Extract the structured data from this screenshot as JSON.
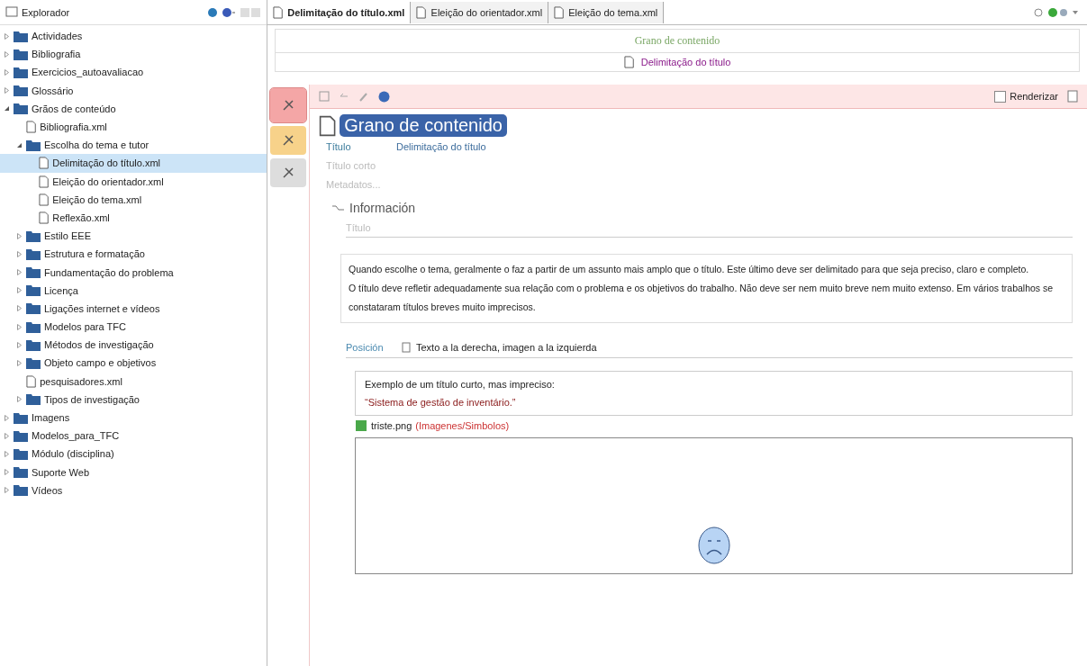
{
  "explorer": {
    "title": "Explorador",
    "tree": [
      {
        "label": "Actividades",
        "kind": "folder",
        "expanded": false,
        "selected": false
      },
      {
        "label": "Bibliografia",
        "kind": "folder",
        "expanded": false,
        "selected": false
      },
      {
        "label": "Exercicios_autoavaliacao",
        "kind": "folder",
        "expanded": false,
        "selected": false
      },
      {
        "label": "Glossário",
        "kind": "folder",
        "expanded": false,
        "selected": false
      },
      {
        "label": "Grãos de conteúdo",
        "kind": "folder",
        "expanded": true,
        "selected": false,
        "children": [
          {
            "label": "Bibliografia.xml",
            "kind": "file",
            "selected": false
          },
          {
            "label": "Escolha do tema e tutor",
            "kind": "folder",
            "expanded": true,
            "selected": false,
            "children": [
              {
                "label": "Delimitação do título.xml",
                "kind": "file",
                "selected": true
              },
              {
                "label": "Eleição do orientador.xml",
                "kind": "file",
                "selected": false
              },
              {
                "label": "Eleição do tema.xml",
                "kind": "file",
                "selected": false
              },
              {
                "label": "Reflexão.xml",
                "kind": "file",
                "selected": false
              }
            ]
          },
          {
            "label": "Estilo EEE",
            "kind": "folder",
            "expanded": false,
            "selected": false
          },
          {
            "label": "Estrutura e formatação",
            "kind": "folder",
            "expanded": false,
            "selected": false
          },
          {
            "label": "Fundamentação do problema",
            "kind": "folder",
            "expanded": false,
            "selected": false
          },
          {
            "label": "Licença",
            "kind": "folder",
            "expanded": false,
            "selected": false
          },
          {
            "label": "Ligações internet e vídeos",
            "kind": "folder",
            "expanded": false,
            "selected": false
          },
          {
            "label": "Modelos para TFC",
            "kind": "folder",
            "expanded": false,
            "selected": false
          },
          {
            "label": "Métodos de investigação",
            "kind": "folder",
            "expanded": false,
            "selected": false
          },
          {
            "label": "Objeto campo e objetivos",
            "kind": "folder",
            "expanded": false,
            "selected": false
          },
          {
            "label": "pesquisadores.xml",
            "kind": "file",
            "selected": false
          },
          {
            "label": "Tipos de investigação",
            "kind": "folder",
            "expanded": false,
            "selected": false
          }
        ]
      },
      {
        "label": "Imagens",
        "kind": "folder",
        "expanded": false,
        "selected": false
      },
      {
        "label": "Modelos_para_TFC",
        "kind": "folder",
        "expanded": false,
        "selected": false
      },
      {
        "label": "Módulo (disciplina)",
        "kind": "folder",
        "expanded": false,
        "selected": false
      },
      {
        "label": "Suporte Web",
        "kind": "folder",
        "expanded": false,
        "selected": false
      },
      {
        "label": "Vídeos",
        "kind": "folder",
        "expanded": false,
        "selected": false
      }
    ]
  },
  "tabs": [
    {
      "label": "Delimitação do título.xml",
      "selected": true
    },
    {
      "label": "Eleição do orientador.xml",
      "selected": false
    },
    {
      "label": "Eleição do tema.xml",
      "selected": false
    }
  ],
  "breadcrumb": {
    "type_name": "Grano de contenido",
    "document": "Delimitação do título"
  },
  "side_tabs": [
    {
      "kind": "edit",
      "selected": true
    },
    {
      "kind": "view",
      "selected": false
    },
    {
      "kind": "other",
      "selected": false
    }
  ],
  "render_option": {
    "label": "Renderizar",
    "checked": false
  },
  "document": {
    "heading": "Grano de contenido",
    "fields": [
      {
        "label": "Título",
        "value": "Delimitação do título",
        "filled": true
      },
      {
        "label": "Título corto",
        "filled": false
      },
      {
        "label": "Metadatos...",
        "filled": false
      }
    ],
    "section": {
      "heading": "Información",
      "field_label": "Título"
    },
    "paragraphs": [
      "Quando escolhe o tema, geralmente o faz a partir de um assunto mais amplo que o título. Este último deve ser delimitado para que seja preciso, claro e completo.",
      "O título deve refletir adequadamente sua relação com o problema e os objetivos do trabalho. Não deve ser nem muito breve nem muito extenso. Em vários trabalhos se constataram títulos breves muito imprecisos."
    ],
    "position": {
      "label": "Posición",
      "value": "Texto a la derecha, imagen a la izquierda"
    },
    "example": [
      "Exemplo de um título curto, mas impreciso:",
      "“Sistema de gestão de inventário.”"
    ],
    "image": {
      "file": "triste.png",
      "path": "(Imagenes/Simbolos)"
    }
  }
}
